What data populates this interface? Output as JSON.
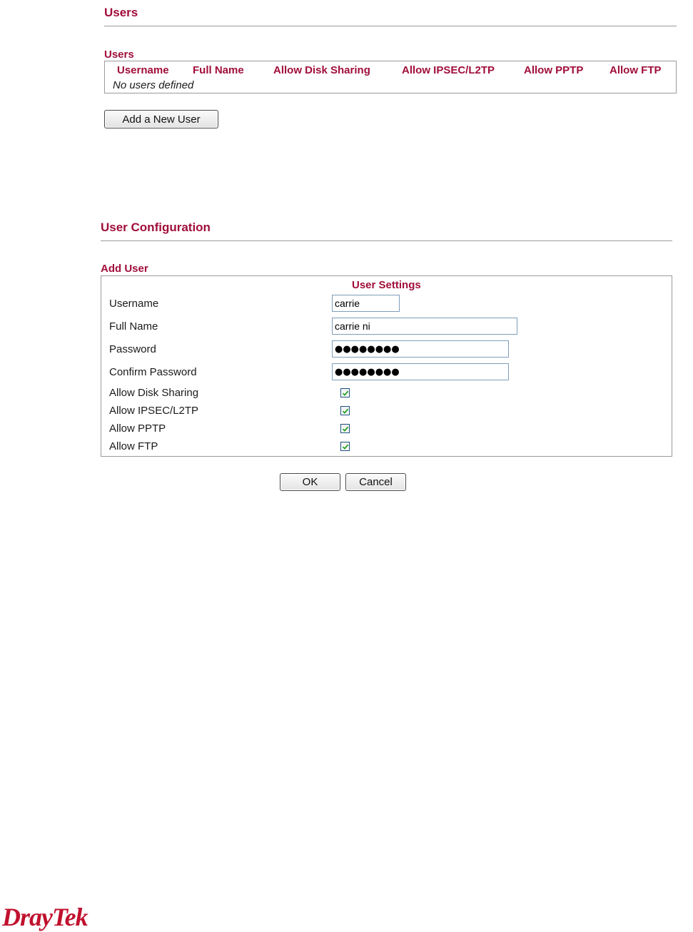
{
  "users_section": {
    "title": "Users",
    "table_caption": "Users",
    "columns": [
      "Username",
      "Full Name",
      "Allow Disk Sharing",
      "Allow IPSEC/L2TP",
      "Allow PPTP",
      "Allow FTP"
    ],
    "empty_text": "No users defined",
    "add_button": "Add a New User"
  },
  "config_section": {
    "title": "User Configuration",
    "box_caption": "Add User",
    "settings_header": "User Settings",
    "fields": {
      "username": {
        "label": "Username",
        "value": "carrie"
      },
      "full_name": {
        "label": "Full Name",
        "value": "carrie ni"
      },
      "password": {
        "label": "Password",
        "value": "●●●●●●●●"
      },
      "confirm_password": {
        "label": "Confirm Password",
        "value": "●●●●●●●●"
      }
    },
    "permissions": [
      {
        "label": "Allow Disk Sharing",
        "checked": true
      },
      {
        "label": "Allow IPSEC/L2TP",
        "checked": true
      },
      {
        "label": "Allow PPTP",
        "checked": true
      },
      {
        "label": "Allow FTP",
        "checked": true
      }
    ],
    "ok_button": "OK",
    "cancel_button": "Cancel"
  },
  "brand": {
    "logo_text": "DrayTek",
    "accent_color": "#a00e3a"
  }
}
